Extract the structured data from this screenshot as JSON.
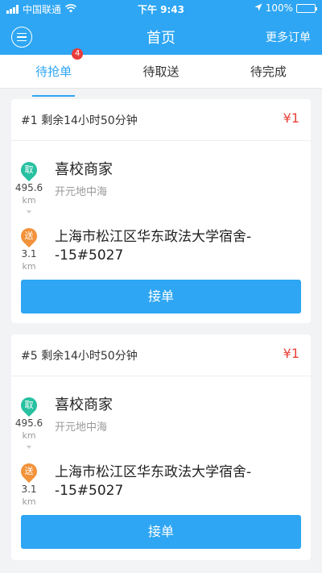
{
  "status_bar": {
    "carrier": "中国联通",
    "time": "下午 9:43",
    "battery": "100%"
  },
  "header": {
    "title": "首页",
    "more": "更多订单"
  },
  "tabs": [
    {
      "label": "待抢单",
      "badge": "4",
      "active": true
    },
    {
      "label": "待取送",
      "active": false
    },
    {
      "label": "待完成",
      "active": false
    }
  ],
  "orders": [
    {
      "head": "#1 剩余14小时50分钟",
      "price": "¥1",
      "pickup_pin": "取",
      "pickup_distance": "495.6",
      "pickup_unit": "km",
      "pickup_name": "喜校商家",
      "pickup_sub": "开元地中海",
      "delivery_pin": "送",
      "delivery_distance": "3.1",
      "delivery_unit": "km",
      "delivery_address": "上海市松江区华东政法大学宿舍--15#5027",
      "button": "接单"
    },
    {
      "head": "#5 剩余14小时50分钟",
      "price": "¥1",
      "pickup_pin": "取",
      "pickup_distance": "495.6",
      "pickup_unit": "km",
      "pickup_name": "喜校商家",
      "pickup_sub": "开元地中海",
      "delivery_pin": "送",
      "delivery_distance": "3.1",
      "delivery_unit": "km",
      "delivery_address": "上海市松江区华东政法大学宿舍--15#5027",
      "button": "接单"
    }
  ],
  "colors": {
    "primary": "#2ea6f3",
    "price": "#e8433a",
    "pickup_pin": "#27c0a1",
    "delivery_pin": "#f2923a",
    "badge": "#e83c3c"
  }
}
